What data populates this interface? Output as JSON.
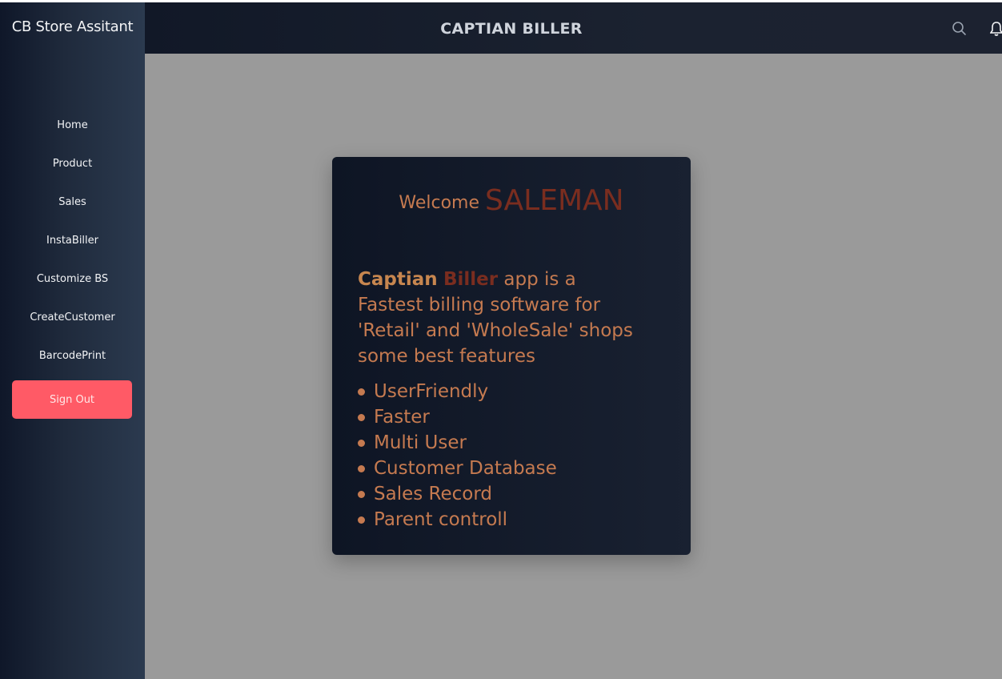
{
  "sidebar": {
    "brand": "CB Store Assitant",
    "items": [
      {
        "label": "Home"
      },
      {
        "label": "Product"
      },
      {
        "label": "Sales"
      },
      {
        "label": "InstaBiller"
      },
      {
        "label": "Customize BS"
      },
      {
        "label": "CreateCustomer"
      },
      {
        "label": "BarcodePrint"
      }
    ],
    "signout_label": "Sign Out"
  },
  "header": {
    "title": "CAPTIAN BILLER",
    "icons": [
      "search-icon",
      "bell-icon"
    ]
  },
  "card": {
    "welcome_text": "Welcome",
    "role": "SALEMAN",
    "desc_bold1": "Captian",
    "desc_bold2": "Biller",
    "desc_rest": "app is a Fastest billing software for 'Retail' and 'WholeSale' shops some best features",
    "features": [
      "UserFriendly",
      "Faster",
      "Multi User",
      "Customer Database",
      "Sales Record",
      "Parent controll"
    ]
  },
  "colors": {
    "accent_text": "#c57a50",
    "accent_dark": "#7a2d1f",
    "signout_bg": "#ff5a66",
    "content_bg": "#9a9a9a",
    "sidebar_dark": "#0f1729"
  }
}
